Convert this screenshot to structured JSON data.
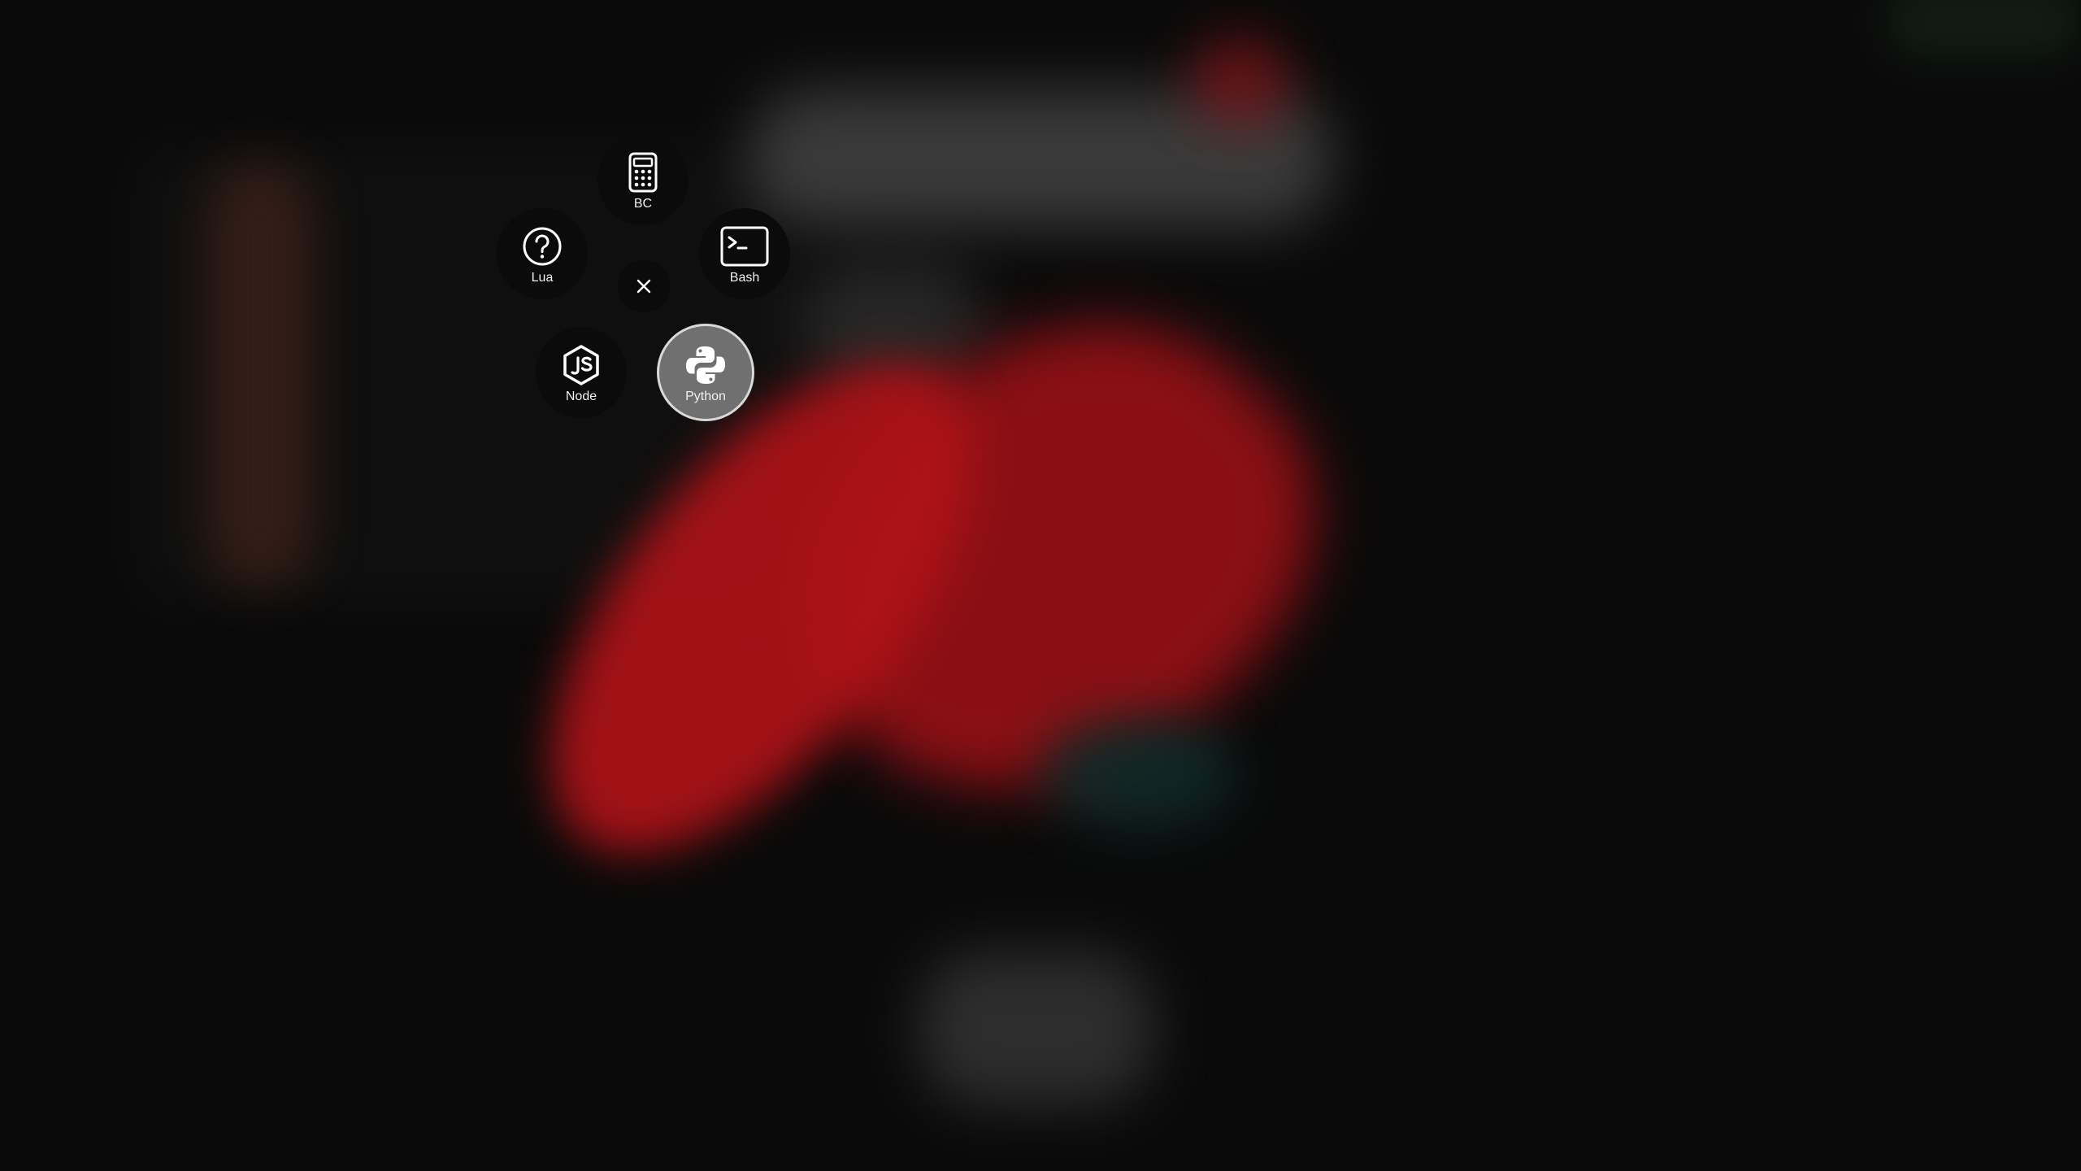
{
  "radial_menu": {
    "items": [
      {
        "id": "bc",
        "label": "BC",
        "icon": "calculator-icon",
        "selected": false
      },
      {
        "id": "lua",
        "label": "Lua",
        "icon": "question-circle-icon",
        "selected": false
      },
      {
        "id": "bash",
        "label": "Bash",
        "icon": "terminal-icon",
        "selected": false
      },
      {
        "id": "node",
        "label": "Node",
        "icon": "nodejs-icon",
        "selected": false
      },
      {
        "id": "python",
        "label": "Python",
        "icon": "python-icon",
        "selected": true
      }
    ],
    "close_icon": "close-icon"
  },
  "colors": {
    "background": "#0a0a0a",
    "item_background": "#0b0b0b",
    "selected_background": "#707070",
    "selected_border": "#d9d9d9",
    "foreground": "#ffffff"
  }
}
